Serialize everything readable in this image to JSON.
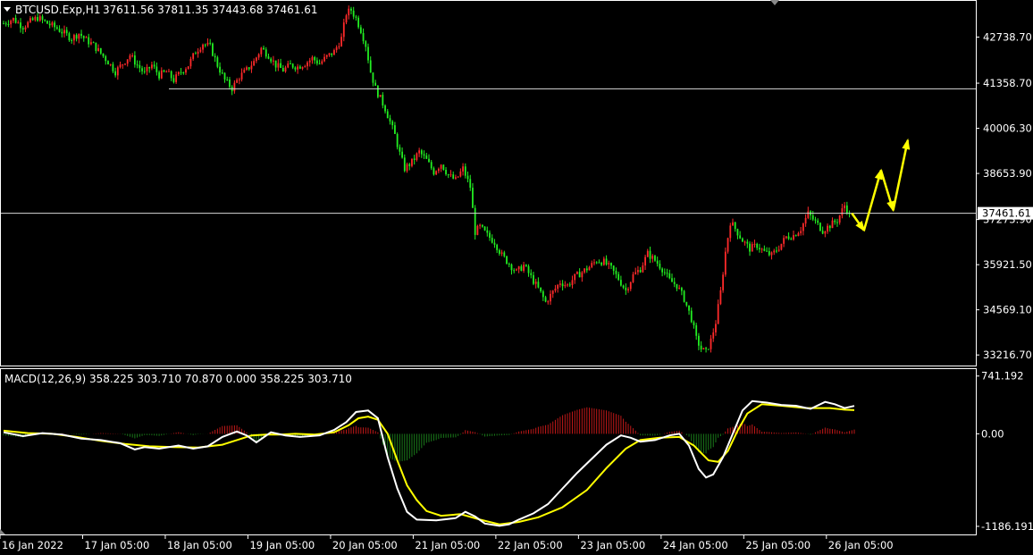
{
  "chart_data": [
    {
      "type": "candlestick",
      "symbol_header": "BTCUSD.Exp,H1",
      "ohlc_header": "37611.56 37811.35 37443.68 37461.61",
      "price_axis": {
        "ticks": [
          "42738.70",
          "41358.70",
          "40006.30",
          "38653.90",
          "37273.90",
          "35921.50",
          "34569.10",
          "33216.70"
        ],
        "tick_values": [
          42738.7,
          41358.7,
          40006.3,
          38653.9,
          37273.9,
          35921.5,
          34569.1,
          33216.7
        ],
        "ylim": [
          32900,
          43850
        ]
      },
      "current_price_label": "37461.61",
      "current_price": 37461.61,
      "horizontal_lines": [
        41190,
        37461.61
      ],
      "close_path": [
        {
          "t": 0,
          "c": 43150
        },
        {
          "t": 4,
          "c": 43280
        },
        {
          "t": 8,
          "c": 43050
        },
        {
          "t": 11,
          "c": 43200
        },
        {
          "t": 14,
          "c": 43320
        },
        {
          "t": 18,
          "c": 43150
        },
        {
          "t": 22,
          "c": 43000
        },
        {
          "t": 25,
          "c": 42850
        },
        {
          "t": 28,
          "c": 42700
        },
        {
          "t": 31,
          "c": 42850
        },
        {
          "t": 34,
          "c": 42650
        },
        {
          "t": 37,
          "c": 42500
        },
        {
          "t": 40,
          "c": 42250
        },
        {
          "t": 43,
          "c": 42000
        },
        {
          "t": 46,
          "c": 41700
        },
        {
          "t": 49,
          "c": 41950
        },
        {
          "t": 52,
          "c": 42200
        },
        {
          "t": 55,
          "c": 41900
        },
        {
          "t": 58,
          "c": 41650
        },
        {
          "t": 61,
          "c": 41900
        },
        {
          "t": 64,
          "c": 41600
        },
        {
          "t": 67,
          "c": 41700
        },
        {
          "t": 70,
          "c": 41450
        },
        {
          "t": 73,
          "c": 41700
        },
        {
          "t": 76,
          "c": 41900
        },
        {
          "t": 79,
          "c": 42300
        },
        {
          "t": 82,
          "c": 42550
        },
        {
          "t": 85,
          "c": 42450
        },
        {
          "t": 88,
          "c": 41900
        },
        {
          "t": 91,
          "c": 41450
        },
        {
          "t": 94,
          "c": 41200
        },
        {
          "t": 97,
          "c": 41550
        },
        {
          "t": 100,
          "c": 41750
        },
        {
          "t": 103,
          "c": 42000
        },
        {
          "t": 106,
          "c": 42400
        },
        {
          "t": 109,
          "c": 42200
        },
        {
          "t": 112,
          "c": 41900
        },
        {
          "t": 115,
          "c": 41750
        },
        {
          "t": 118,
          "c": 41900
        },
        {
          "t": 121,
          "c": 41850
        },
        {
          "t": 124,
          "c": 41950
        },
        {
          "t": 127,
          "c": 42100
        },
        {
          "t": 130,
          "c": 41950
        },
        {
          "t": 133,
          "c": 42150
        },
        {
          "t": 136,
          "c": 42300
        },
        {
          "t": 139,
          "c": 42700
        },
        {
          "t": 141,
          "c": 43450
        },
        {
          "t": 143,
          "c": 43550
        },
        {
          "t": 145,
          "c": 43300
        },
        {
          "t": 147,
          "c": 42950
        },
        {
          "t": 149,
          "c": 42500
        },
        {
          "t": 151,
          "c": 41700
        },
        {
          "t": 153,
          "c": 41200
        },
        {
          "t": 155,
          "c": 40900
        },
        {
          "t": 157,
          "c": 40600
        },
        {
          "t": 159,
          "c": 40200
        },
        {
          "t": 161,
          "c": 39800
        },
        {
          "t": 163,
          "c": 39250
        },
        {
          "t": 165,
          "c": 38800
        },
        {
          "t": 168,
          "c": 39000
        },
        {
          "t": 171,
          "c": 39300
        },
        {
          "t": 174,
          "c": 39050
        },
        {
          "t": 177,
          "c": 38700
        },
        {
          "t": 180,
          "c": 38950
        },
        {
          "t": 183,
          "c": 38600
        },
        {
          "t": 186,
          "c": 38450
        },
        {
          "t": 189,
          "c": 38800
        },
        {
          "t": 192,
          "c": 38250
        },
        {
          "t": 194,
          "c": 36900
        },
        {
          "t": 196,
          "c": 37050
        },
        {
          "t": 199,
          "c": 36800
        },
        {
          "t": 202,
          "c": 36600
        },
        {
          "t": 205,
          "c": 36200
        },
        {
          "t": 208,
          "c": 35950
        },
        {
          "t": 211,
          "c": 35700
        },
        {
          "t": 214,
          "c": 35900
        },
        {
          "t": 217,
          "c": 35550
        },
        {
          "t": 220,
          "c": 35200
        },
        {
          "t": 223,
          "c": 34800
        },
        {
          "t": 226,
          "c": 35100
        },
        {
          "t": 229,
          "c": 35400
        },
        {
          "t": 232,
          "c": 35300
        },
        {
          "t": 235,
          "c": 35550
        },
        {
          "t": 238,
          "c": 35700
        },
        {
          "t": 241,
          "c": 35850
        },
        {
          "t": 244,
          "c": 36050
        },
        {
          "t": 247,
          "c": 36000
        },
        {
          "t": 250,
          "c": 35800
        },
        {
          "t": 253,
          "c": 35500
        },
        {
          "t": 256,
          "c": 35150
        },
        {
          "t": 259,
          "c": 35600
        },
        {
          "t": 262,
          "c": 35800
        },
        {
          "t": 265,
          "c": 36250
        },
        {
          "t": 268,
          "c": 36050
        },
        {
          "t": 271,
          "c": 35800
        },
        {
          "t": 274,
          "c": 35450
        },
        {
          "t": 277,
          "c": 35300
        },
        {
          "t": 280,
          "c": 34900
        },
        {
          "t": 283,
          "c": 34300
        },
        {
          "t": 285,
          "c": 33700
        },
        {
          "t": 287,
          "c": 33400
        },
        {
          "t": 289,
          "c": 33300
        },
        {
          "t": 291,
          "c": 33650
        },
        {
          "t": 293,
          "c": 34200
        },
        {
          "t": 295,
          "c": 35100
        },
        {
          "t": 297,
          "c": 36300
        },
        {
          "t": 299,
          "c": 37200
        },
        {
          "t": 301,
          "c": 37000
        },
        {
          "t": 304,
          "c": 36650
        },
        {
          "t": 307,
          "c": 36400
        },
        {
          "t": 310,
          "c": 36500
        },
        {
          "t": 313,
          "c": 36300
        },
        {
          "t": 316,
          "c": 36200
        },
        {
          "t": 319,
          "c": 36450
        },
        {
          "t": 322,
          "c": 36750
        },
        {
          "t": 325,
          "c": 36800
        },
        {
          "t": 328,
          "c": 37000
        },
        {
          "t": 331,
          "c": 37450
        },
        {
          "t": 334,
          "c": 37200
        },
        {
          "t": 337,
          "c": 36950
        },
        {
          "t": 340,
          "c": 37100
        },
        {
          "t": 343,
          "c": 37250
        },
        {
          "t": 346,
          "c": 37700
        },
        {
          "t": 348,
          "c": 37450
        }
      ],
      "forecast_arrows": [
        {
          "from": [
            349,
            37461.61
          ],
          "to": [
            354,
            36950
          ]
        },
        {
          "from": [
            354,
            36950
          ],
          "to": [
            361,
            38750
          ]
        },
        {
          "from": [
            361,
            38750
          ],
          "to": [
            366,
            37550
          ]
        },
        {
          "from": [
            366,
            37550
          ],
          "to": [
            372,
            39650
          ]
        }
      ],
      "time_axis": {
        "labels": [
          "16 Jan 2022",
          "17 Jan 05:00",
          "18 Jan 05:00",
          "19 Jan 05:00",
          "20 Jan 05:00",
          "21 Jan 05:00",
          "22 Jan 05:00",
          "23 Jan 05:00",
          "24 Jan 05:00",
          "25 Jan 05:00",
          "26 Jan 05:00"
        ],
        "label_bars": [
          0,
          34,
          68,
          102,
          136,
          170,
          204,
          238,
          272,
          306,
          340
        ]
      },
      "colors": {
        "up": "#ff2a2a",
        "down": "#22ee22",
        "line": "#d8d8d8",
        "arrow": "#ffff00",
        "grid_border": "#ffffff",
        "label_bg": "#ffffff",
        "label_fg": "#000000"
      }
    },
    {
      "type": "macd",
      "header": "MACD(12,26,9) 358.225 303.710 70.870 0.000 358.225 303.710",
      "axis": {
        "ticks": [
          "741.192",
          "0.00",
          "-1186.191"
        ],
        "tick_values": [
          741.192,
          0,
          -1186.191
        ],
        "ylim": [
          -1290,
          830
        ]
      },
      "macd_line": [
        {
          "t": 0,
          "v": 20
        },
        {
          "t": 8,
          "v": -30
        },
        {
          "t": 16,
          "v": 10
        },
        {
          "t": 24,
          "v": -10
        },
        {
          "t": 32,
          "v": -60
        },
        {
          "t": 40,
          "v": -80
        },
        {
          "t": 48,
          "v": -120
        },
        {
          "t": 54,
          "v": -200
        },
        {
          "t": 58,
          "v": -170
        },
        {
          "t": 64,
          "v": -190
        },
        {
          "t": 72,
          "v": -150
        },
        {
          "t": 78,
          "v": -190
        },
        {
          "t": 84,
          "v": -160
        },
        {
          "t": 90,
          "v": -40
        },
        {
          "t": 96,
          "v": 30
        },
        {
          "t": 100,
          "v": -20
        },
        {
          "t": 104,
          "v": -110
        },
        {
          "t": 110,
          "v": 20
        },
        {
          "t": 116,
          "v": -20
        },
        {
          "t": 122,
          "v": -40
        },
        {
          "t": 130,
          "v": -20
        },
        {
          "t": 136,
          "v": 50
        },
        {
          "t": 141,
          "v": 150
        },
        {
          "t": 145,
          "v": 280
        },
        {
          "t": 150,
          "v": 300
        },
        {
          "t": 154,
          "v": 200
        },
        {
          "t": 158,
          "v": -300
        },
        {
          "t": 162,
          "v": -700
        },
        {
          "t": 166,
          "v": -1000
        },
        {
          "t": 170,
          "v": -1100
        },
        {
          "t": 178,
          "v": -1110
        },
        {
          "t": 186,
          "v": -1080
        },
        {
          "t": 190,
          "v": -1000
        },
        {
          "t": 194,
          "v": -1060
        },
        {
          "t": 198,
          "v": -1150
        },
        {
          "t": 204,
          "v": -1180
        },
        {
          "t": 208,
          "v": -1160
        },
        {
          "t": 212,
          "v": -1100
        },
        {
          "t": 218,
          "v": -1020
        },
        {
          "t": 224,
          "v": -900
        },
        {
          "t": 230,
          "v": -700
        },
        {
          "t": 236,
          "v": -500
        },
        {
          "t": 242,
          "v": -320
        },
        {
          "t": 248,
          "v": -140
        },
        {
          "t": 254,
          "v": -20
        },
        {
          "t": 258,
          "v": -50
        },
        {
          "t": 262,
          "v": -100
        },
        {
          "t": 268,
          "v": -80
        },
        {
          "t": 274,
          "v": -20
        },
        {
          "t": 278,
          "v": 0
        },
        {
          "t": 282,
          "v": -150
        },
        {
          "t": 286,
          "v": -450
        },
        {
          "t": 289,
          "v": -560
        },
        {
          "t": 292,
          "v": -520
        },
        {
          "t": 296,
          "v": -300
        },
        {
          "t": 300,
          "v": 0
        },
        {
          "t": 304,
          "v": 300
        },
        {
          "t": 308,
          "v": 420
        },
        {
          "t": 314,
          "v": 400
        },
        {
          "t": 320,
          "v": 370
        },
        {
          "t": 326,
          "v": 360
        },
        {
          "t": 332,
          "v": 320
        },
        {
          "t": 338,
          "v": 410
        },
        {
          "t": 342,
          "v": 380
        },
        {
          "t": 346,
          "v": 330
        },
        {
          "t": 350,
          "v": 358.225
        }
      ],
      "signal_line": [
        {
          "t": 0,
          "v": 40
        },
        {
          "t": 10,
          "v": 10
        },
        {
          "t": 20,
          "v": 0
        },
        {
          "t": 30,
          "v": -40
        },
        {
          "t": 40,
          "v": -90
        },
        {
          "t": 50,
          "v": -130
        },
        {
          "t": 60,
          "v": -160
        },
        {
          "t": 70,
          "v": -170
        },
        {
          "t": 80,
          "v": -175
        },
        {
          "t": 90,
          "v": -140
        },
        {
          "t": 96,
          "v": -80
        },
        {
          "t": 102,
          "v": -20
        },
        {
          "t": 108,
          "v": -10
        },
        {
          "t": 114,
          "v": -10
        },
        {
          "t": 120,
          "v": 0
        },
        {
          "t": 128,
          "v": -10
        },
        {
          "t": 136,
          "v": 20
        },
        {
          "t": 142,
          "v": 110
        },
        {
          "t": 146,
          "v": 200
        },
        {
          "t": 150,
          "v": 220
        },
        {
          "t": 154,
          "v": 180
        },
        {
          "t": 158,
          "v": 0
        },
        {
          "t": 162,
          "v": -340
        },
        {
          "t": 166,
          "v": -660
        },
        {
          "t": 170,
          "v": -850
        },
        {
          "t": 174,
          "v": -990
        },
        {
          "t": 180,
          "v": -1050
        },
        {
          "t": 188,
          "v": -1030
        },
        {
          "t": 196,
          "v": -1100
        },
        {
          "t": 204,
          "v": -1160
        },
        {
          "t": 212,
          "v": -1130
        },
        {
          "t": 220,
          "v": -1070
        },
        {
          "t": 230,
          "v": -940
        },
        {
          "t": 240,
          "v": -720
        },
        {
          "t": 248,
          "v": -440
        },
        {
          "t": 256,
          "v": -190
        },
        {
          "t": 262,
          "v": -80
        },
        {
          "t": 270,
          "v": -50
        },
        {
          "t": 278,
          "v": -40
        },
        {
          "t": 284,
          "v": -150
        },
        {
          "t": 290,
          "v": -340
        },
        {
          "t": 294,
          "v": -360
        },
        {
          "t": 298,
          "v": -220
        },
        {
          "t": 302,
          "v": 40
        },
        {
          "t": 306,
          "v": 260
        },
        {
          "t": 312,
          "v": 380
        },
        {
          "t": 320,
          "v": 360
        },
        {
          "t": 330,
          "v": 330
        },
        {
          "t": 340,
          "v": 330
        },
        {
          "t": 346,
          "v": 310
        },
        {
          "t": 350,
          "v": 303.71
        }
      ],
      "colors": {
        "macd": "#ffffff",
        "signal": "#ffff00",
        "hist_up": "#c01818",
        "hist_down": "#1a7a1a"
      }
    }
  ]
}
